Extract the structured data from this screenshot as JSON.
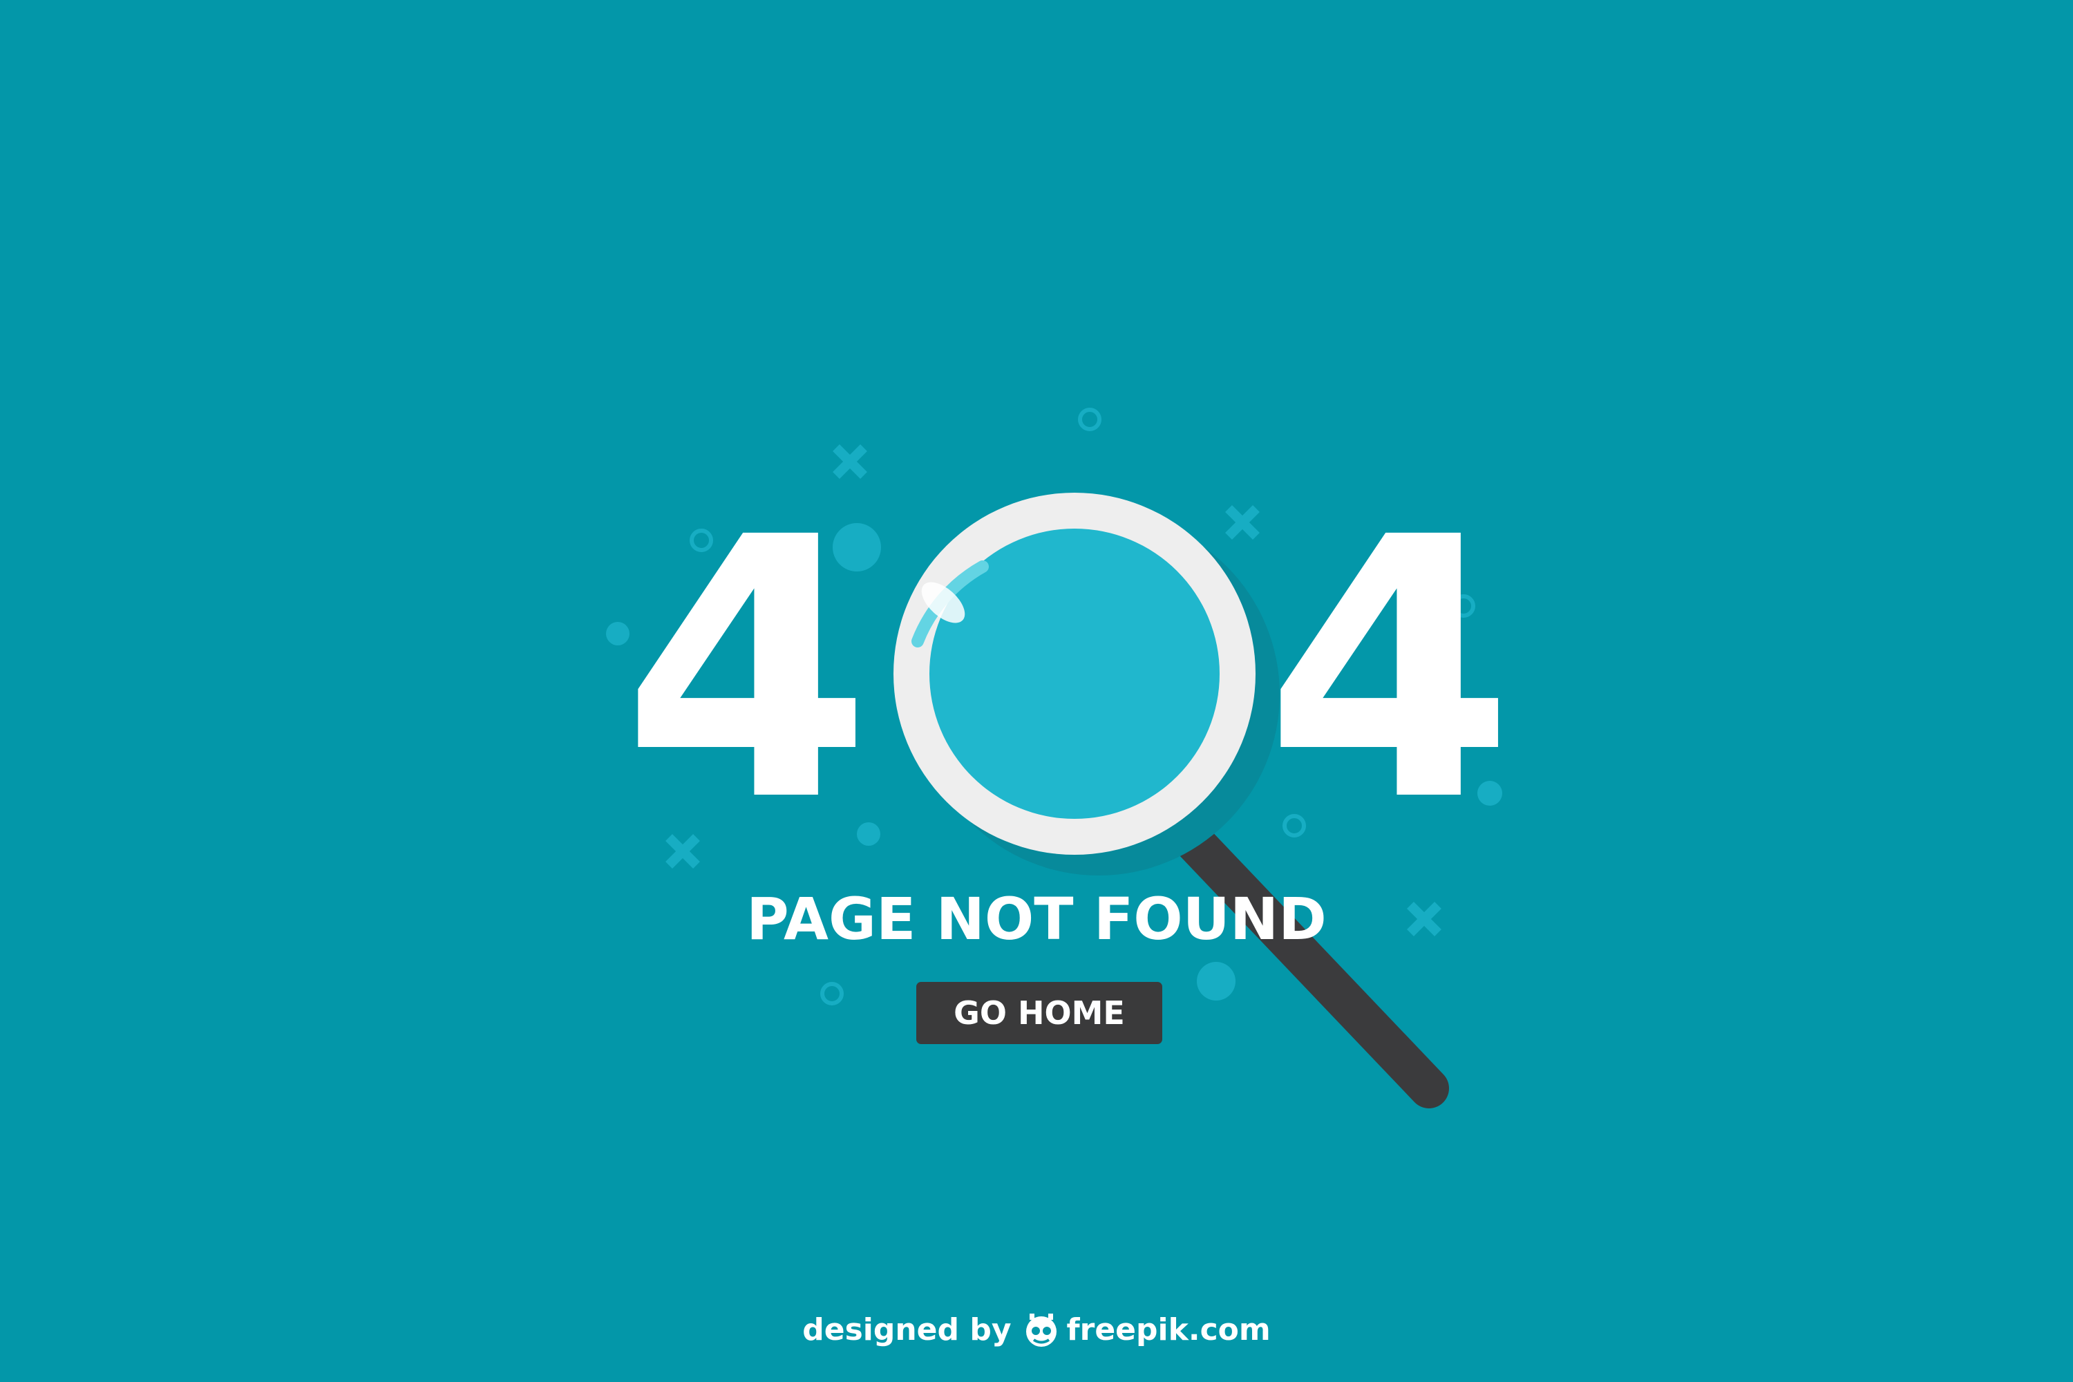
{
  "error_code": {
    "left_digit": "4",
    "right_digit": "4"
  },
  "message": "PAGE NOT FOUND",
  "home_button_label": "GO HOME",
  "credit": {
    "prefix": "designed by",
    "brand": "freepik.com",
    "icon": "freepik-logo-icon"
  },
  "illustration": {
    "icon": "magnifying-glass-icon",
    "stands_for_digit": "0"
  },
  "colors": {
    "background": "#0397a9",
    "text": "#ffffff",
    "button": "#3a3a3b",
    "lens": "#20b7cd",
    "lens_rim": "#eeeeee",
    "handle": "#3b3b3d",
    "decor": "#17adc3"
  }
}
